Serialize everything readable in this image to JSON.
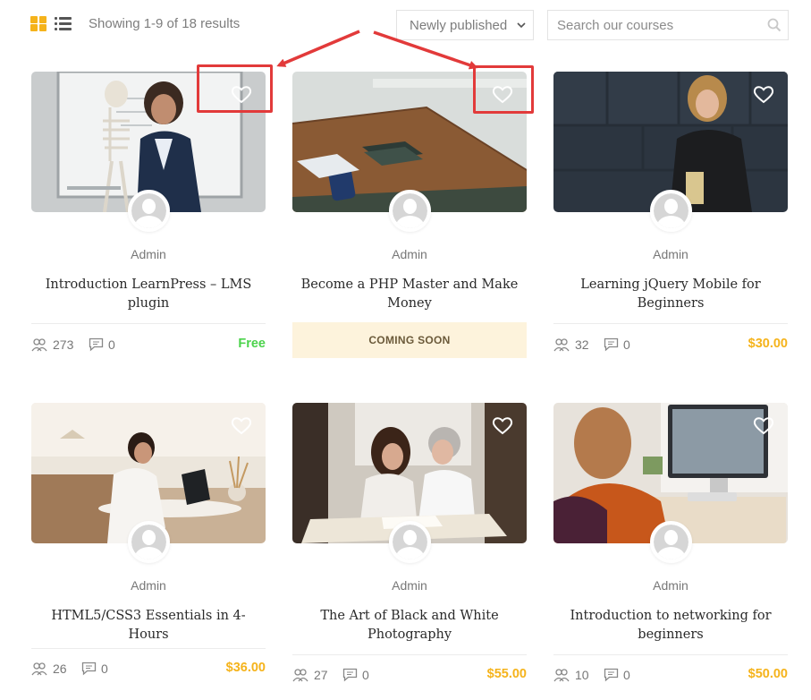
{
  "toolbar": {
    "result_count": "Showing 1-9 of 18 results",
    "sort_value": "Newly published",
    "search_placeholder": "Search our courses"
  },
  "courses": [
    {
      "instructor": "Admin",
      "title": "Introduction LearnPress – LMS plugin",
      "students": "273",
      "comments": "0",
      "price": "Free",
      "coming_soon": ""
    },
    {
      "instructor": "Admin",
      "title": "Become a PHP Master and Make Money",
      "students": "",
      "comments": "",
      "price": "",
      "coming_soon": "COMING SOON"
    },
    {
      "instructor": "Admin",
      "title": "Learning jQuery Mobile for Beginners",
      "students": "32",
      "comments": "0",
      "price": "$30.00",
      "coming_soon": ""
    },
    {
      "instructor": "Admin",
      "title": "HTML5/CSS3 Essentials in 4-Hours",
      "students": "26",
      "comments": "0",
      "price": "$36.00",
      "coming_soon": ""
    },
    {
      "instructor": "Admin",
      "title": "The Art of Black and White Photography",
      "students": "27",
      "comments": "0",
      "price": "$55.00",
      "coming_soon": ""
    },
    {
      "instructor": "Admin",
      "title": "Introduction to networking for beginners",
      "students": "10",
      "comments": "0",
      "price": "$50.00",
      "coming_soon": ""
    }
  ],
  "colors": {
    "accent": "#f5b31b",
    "free": "#4bd34b",
    "coming_soon_bg": "#fdf3dc",
    "annotation": "#e23a3a"
  },
  "icons": [
    "grid-view-icon",
    "list-view-icon",
    "chevron-down-icon",
    "search-icon",
    "heart-icon",
    "students-icon",
    "comments-icon",
    "user-avatar-icon"
  ]
}
